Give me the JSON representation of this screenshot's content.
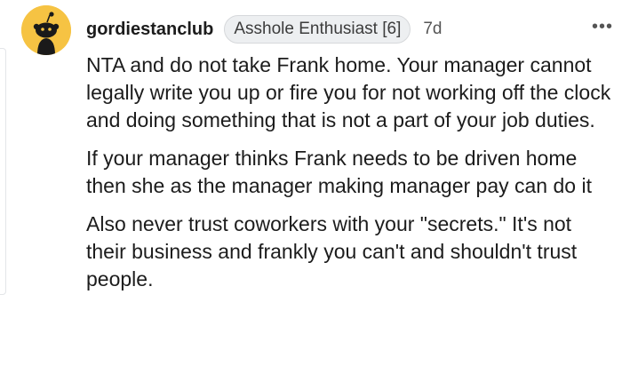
{
  "comment": {
    "username": "gordiestanclub",
    "flair": "Asshole Enthusiast [6]",
    "age": "7d",
    "more_label": "•••",
    "paragraphs": [
      "NTA and do not take Frank home. Your manager cannot legally write you up or fire you for not working off the clock and doing something that is not a part of your job duties.",
      "If your manager thinks Frank needs to be driven home then she as the manager making manager pay can do it",
      "Also never trust coworkers with your \"secrets.\" It's not their business and frankly you can't and shouldn't trust people."
    ]
  },
  "colors": {
    "avatar_bg": "#f6c343",
    "text": "#1c1c1c",
    "flair_bg": "#edeff1"
  },
  "icons": {
    "avatar": "snoo-avatar-icon",
    "more": "more-options-icon"
  }
}
